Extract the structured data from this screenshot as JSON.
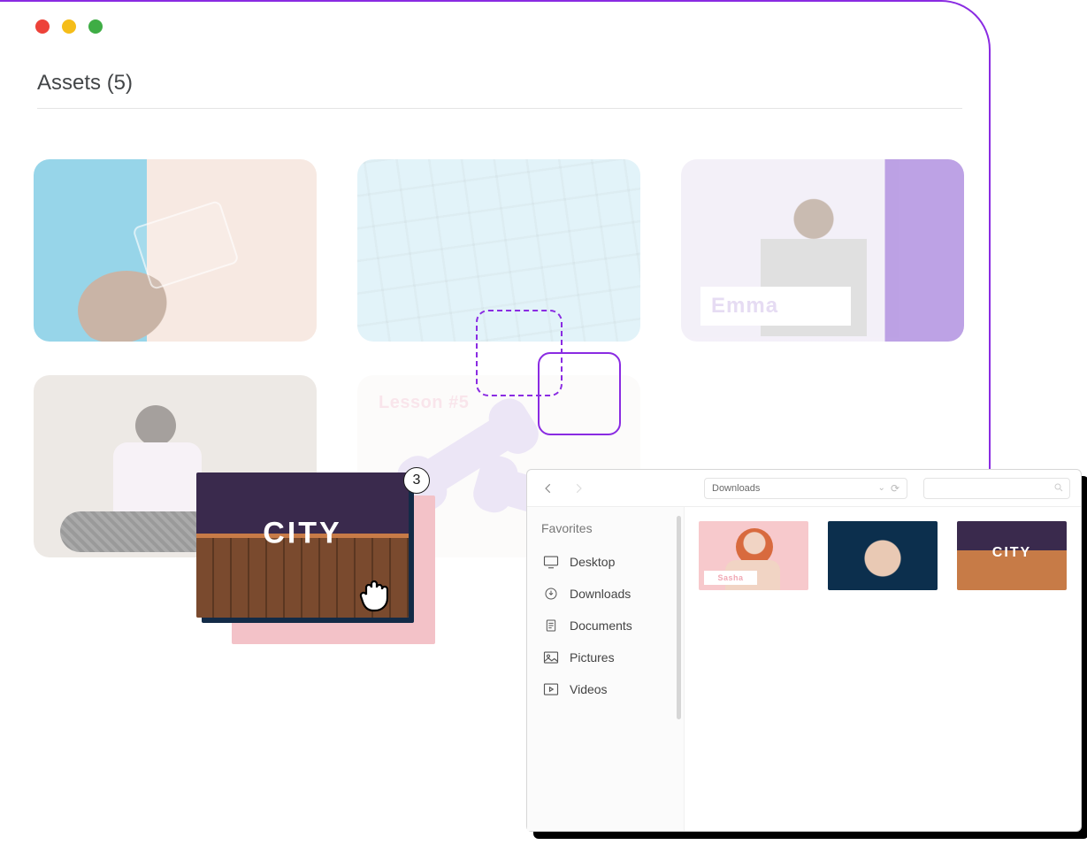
{
  "page": {
    "title": "Assets (5)"
  },
  "assets": {
    "card3_name": "Emma",
    "card5_lesson": "Lesson #5"
  },
  "drag": {
    "city_label": "CITY",
    "badge_count": "3"
  },
  "filebrowser": {
    "address": "Downloads",
    "sidebar_heading": "Favorites",
    "sidebar": {
      "desktop": "Desktop",
      "downloads": "Downloads",
      "documents": "Documents",
      "pictures": "Pictures",
      "videos": "Videos"
    },
    "thumbs": {
      "sasha_label": "Sasha",
      "city_label": "CITY"
    }
  }
}
